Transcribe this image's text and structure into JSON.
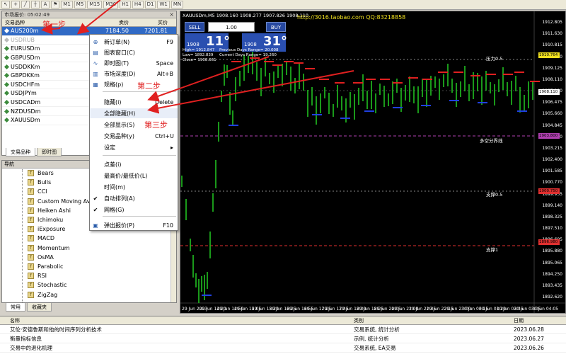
{
  "toolbar": {
    "buttons": [
      "↖",
      "+",
      "╱",
      "┼",
      "A",
      "⚑",
      "M1",
      "M5",
      "M15",
      "M30",
      "H1",
      "H4",
      "D1",
      "W1",
      "MN"
    ]
  },
  "market_watch": {
    "title": "市场报价: 05:02:49",
    "close": "×",
    "col_symbol": "交易品种",
    "col_bid": "卖价",
    "col_ask": "买价",
    "rows": [
      {
        "symbol": "AUS200m",
        "bid": "7184.50",
        "ask": "7201.81"
      },
      {
        "symbol": "USDRUB",
        "bid": "",
        "ask": ""
      },
      {
        "symbol": "EURUSDm",
        "bid": "",
        "ask": ""
      },
      {
        "symbol": "GBPUSDm",
        "bid": "",
        "ask": ""
      },
      {
        "symbol": "USDDKKm",
        "bid": "",
        "ask": ""
      },
      {
        "symbol": "GBPDKKm",
        "bid": "",
        "ask": ""
      },
      {
        "symbol": "USDCHFm",
        "bid": "",
        "ask": ""
      },
      {
        "symbol": "USDJPYm",
        "bid": "",
        "ask": ""
      },
      {
        "symbol": "USDCADm",
        "bid": "",
        "ask": ""
      },
      {
        "symbol": "NZDUSDm",
        "bid": "",
        "ask": ""
      },
      {
        "symbol": "XAUUSDm",
        "bid": "",
        "ask": ""
      }
    ],
    "tabs": [
      "交易品种",
      "即时图"
    ]
  },
  "navigator": {
    "title": "导航",
    "items": [
      "Bears",
      "Bulls",
      "CCI",
      "Custom Moving Av",
      "Heiken Ashi",
      "Ichimoku",
      "iExposure",
      "MACD",
      "Momentum",
      "OsMA",
      "Parabolic",
      "RSI",
      "Stochastic",
      "ZigZag"
    ],
    "tabs": [
      "常用",
      "收藏夹"
    ]
  },
  "context_menu": {
    "items": [
      {
        "label": "新订单(N)",
        "key": "F9",
        "icon": "new-order-icon"
      },
      {
        "label": "图表窗口(C)",
        "key": "",
        "icon": "chart-window-icon"
      },
      {
        "label": "即时图(T)",
        "key": "Space",
        "icon": "tick-chart-icon"
      },
      {
        "label": "市场深度(D)",
        "key": "Alt+B",
        "icon": "depth-icon"
      },
      {
        "label": "规格(p)",
        "key": "",
        "icon": "spec-icon"
      },
      {
        "label": "隐藏(i)",
        "key": "Delete",
        "icon": ""
      },
      {
        "label": "全部隐藏(H)",
        "key": "",
        "icon": ""
      },
      {
        "label": "全部显示(S)",
        "key": "",
        "icon": ""
      },
      {
        "label": "交易品种(y)",
        "key": "Ctrl+U",
        "icon": ""
      },
      {
        "label": "设定",
        "key": "▸",
        "icon": ""
      },
      {
        "label": "点差(i)",
        "key": "",
        "icon": ""
      },
      {
        "label": "最高价/最低价(L)",
        "key": "",
        "icon": ""
      },
      {
        "label": "时间(m)",
        "key": "",
        "icon": ""
      },
      {
        "label": "自动排列(A)",
        "key": "",
        "icon": "check-icon"
      },
      {
        "label": "网格(G)",
        "key": "",
        "icon": "check-icon"
      },
      {
        "label": "弹出报价(P)",
        "key": "F10",
        "icon": "popup-icon"
      }
    ]
  },
  "annotations": {
    "step1": "第一步",
    "step2": "第二步",
    "step3": "第三步"
  },
  "chart": {
    "title": "XAUUSDm,M5  1908.160 1908.277 1907.826 1908.110",
    "qq": "http://3016.taobao.com QQ:83218858",
    "sell": "SELL",
    "buy": "BUY",
    "lot": "1.00",
    "sell_small": "1908",
    "sell_big": "11°",
    "buy_small": "1908",
    "buy_big": "31°",
    "info_left": [
      "High= 1912.847",
      "Low= 1892.839",
      "Close= 1908.661"
    ],
    "info_right": [
      "Previous Days Range= 20.008",
      "Current Days Range= 19.260"
    ],
    "price_axis": [
      "1912.805",
      "1911.630",
      "1910.815",
      "1909.960",
      "1909.125",
      "1908.110",
      "1907.290",
      "1906.475",
      "1905.660",
      "1904.845",
      "1904.030",
      "1903.215",
      "1902.400",
      "1901.585",
      "1900.770",
      "1899.955",
      "1899.140",
      "1898.325",
      "1897.510",
      "1896.695",
      "1895.880",
      "1895.065",
      "1894.250",
      "1893.435",
      "1892.620"
    ],
    "price_tags": [
      {
        "value": "1910.764",
        "color": "#f0e020"
      },
      {
        "value": "1908.110",
        "color": "#ffffff"
      },
      {
        "value": "1903.800",
        "color": "#b040b0"
      },
      {
        "value": "1900.750",
        "color": "#e03030"
      },
      {
        "value": "1896.980",
        "color": "#e03030"
      }
    ],
    "levels": [
      "压力0.5",
      "多空分界线",
      "支撑0.5",
      "支撑1"
    ],
    "times": [
      "29 Jun 2023",
      "29 Jun 14:20",
      "29 Jun 14:50",
      "29 Jun 15:05",
      "29 Jun 15:20",
      "29 Jun 16:25",
      "29 Jun 16:55",
      "29 Jun 17:25",
      "29 Jun 17:45",
      "29 Jun 18:00",
      "29 Jun 18:25",
      "29 Jun 20:05",
      "29 Jun 21:00",
      "29 Jun 21:35",
      "29 Jun 22:15",
      "29 Jun 23:00",
      "30 Jun 00:15",
      "30 Jun 01:20",
      "30 Jun 02:45",
      "30 Jun 03:05",
      "30 Jun 04:05"
    ],
    "colors": {
      "up": "#20c020",
      "down": "#20c020",
      "high_mark": "#e02020",
      "low_mark": "#2040e0"
    }
  },
  "bottom_panel": {
    "col_name": "名称",
    "col_category": "类别",
    "col_date": "日期",
    "rows": [
      {
        "name": "艾伦·安德鲁斯和他的时间序列分析技术",
        "category": "交易系统, 统计分析",
        "date": "2023.06.28"
      },
      {
        "name": "衡量指标信息",
        "category": "示例, 统计分析",
        "date": "2023.06.27"
      },
      {
        "name": "交易中的退化机理",
        "category": "交易系统, EA交易",
        "date": "2023.06.26"
      }
    ]
  }
}
